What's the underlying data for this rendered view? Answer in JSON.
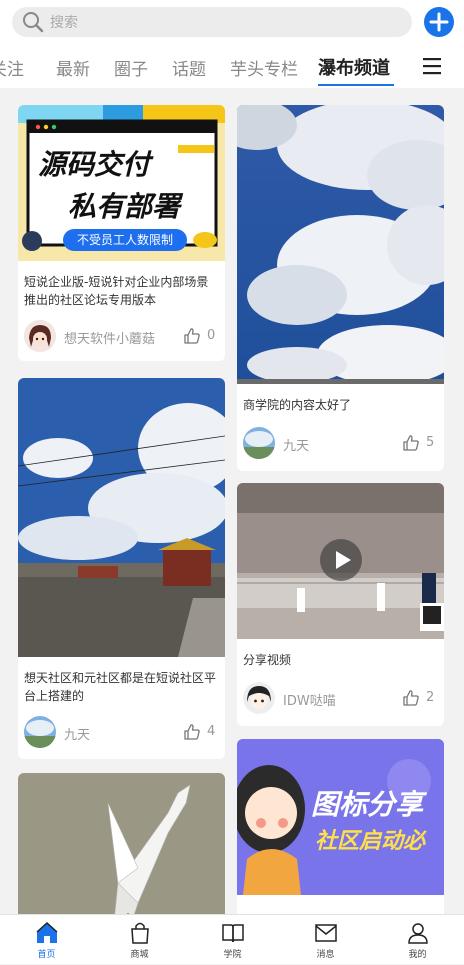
{
  "search": {
    "placeholder": "搜索"
  },
  "tabs": [
    {
      "label": "关注"
    },
    {
      "label": "最新"
    },
    {
      "label": "圈子"
    },
    {
      "label": "话题"
    },
    {
      "label": "芋头专栏"
    },
    {
      "label": "瀑布频道"
    }
  ],
  "banner": {
    "line1": "源码交付",
    "line2": "私有部署",
    "pill": "不受员工人数限制"
  },
  "banner2": {
    "line1": "图标分享",
    "line2": "社区启动必"
  },
  "cards": [
    {
      "title": "短说企业版-短说针对企业内部场景推出的社区论坛专用版本",
      "author": "想天软件小蘑菇",
      "likes": "0"
    },
    {
      "title": "商学院的内容太好了",
      "author": "九天",
      "likes": "5"
    },
    {
      "title": "想天社区和元社区都是在短说社区平台上搭建的",
      "author": "九天",
      "likes": "4"
    },
    {
      "title": "分享视频",
      "author": "IDW哒喵",
      "likes": "2"
    }
  ],
  "nav": [
    {
      "label": "首页",
      "icon": "home-icon"
    },
    {
      "label": "商城",
      "icon": "bag-icon"
    },
    {
      "label": "学院",
      "icon": "book-icon"
    },
    {
      "label": "消息",
      "icon": "mail-icon"
    },
    {
      "label": "我的",
      "icon": "user-icon"
    }
  ],
  "colors": {
    "accent": "#1a73e8"
  }
}
